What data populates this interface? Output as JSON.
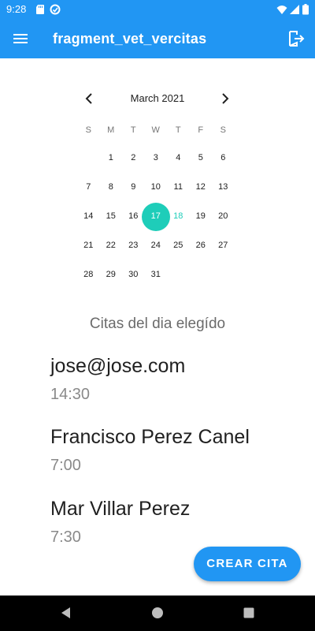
{
  "status_bar": {
    "time": "9:28"
  },
  "app_bar": {
    "title": "fragment_vet_vercitas"
  },
  "calendar": {
    "month_label": "March 2021",
    "weekdays": [
      "S",
      "M",
      "T",
      "W",
      "T",
      "F",
      "S"
    ],
    "weeks": [
      [
        "",
        "1",
        "2",
        "3",
        "4",
        "5",
        "6"
      ],
      [
        "7",
        "8",
        "9",
        "10",
        "11",
        "12",
        "13"
      ],
      [
        "14",
        "15",
        "16",
        "17",
        "18",
        "19",
        "20"
      ],
      [
        "21",
        "22",
        "23",
        "24",
        "25",
        "26",
        "27"
      ],
      [
        "28",
        "29",
        "30",
        "31",
        "",
        "",
        ""
      ]
    ],
    "selected_day": "17",
    "today": "18",
    "accent_color": "#1ECDB9"
  },
  "list": {
    "title": "Citas del dia elegído",
    "appointments": [
      {
        "name": "jose@jose.com",
        "time": "14:30"
      },
      {
        "name": "Francisco Perez Canel",
        "time": "7:00"
      },
      {
        "name": "Mar Villar Perez",
        "time": "7:30"
      }
    ]
  },
  "fab": {
    "label": "CREAR CITA"
  },
  "colors": {
    "primary": "#2196F3"
  },
  "icons": {
    "menu": "hamburger-menu-icon",
    "logout": "logout-icon",
    "prev": "chevron-left-icon",
    "next": "chevron-right-icon"
  }
}
